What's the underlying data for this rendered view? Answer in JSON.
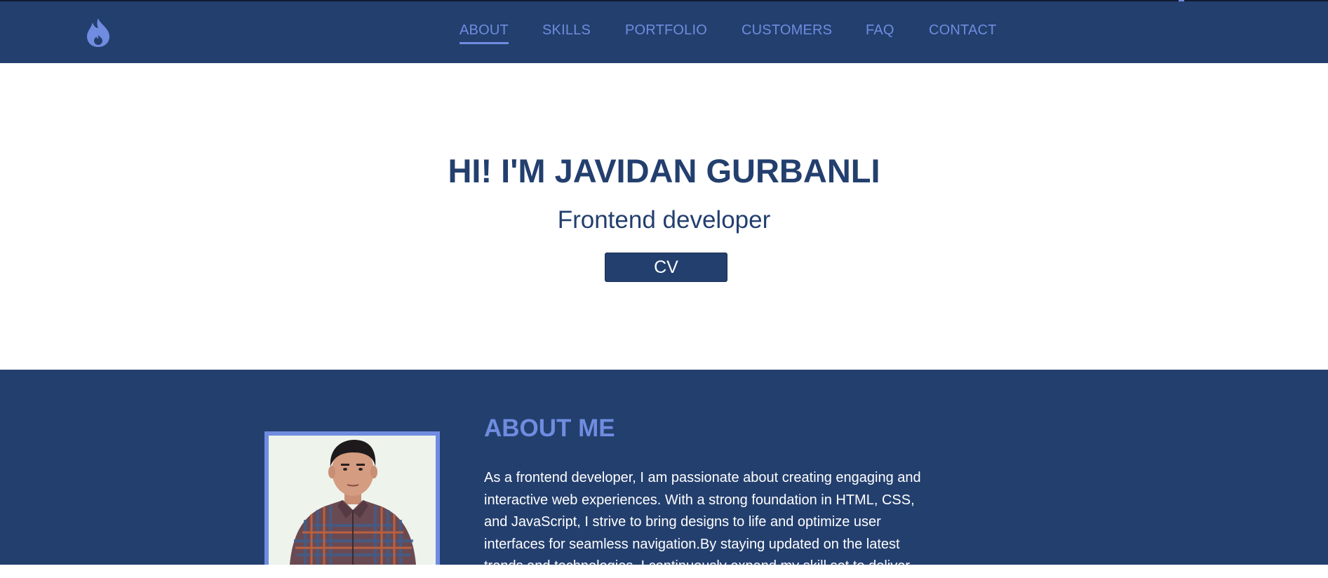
{
  "nav": {
    "items": [
      {
        "label": "ABOUT",
        "active": true
      },
      {
        "label": "SKILLS",
        "active": false
      },
      {
        "label": "PORTFOLIO",
        "active": false
      },
      {
        "label": "CUSTOMERS",
        "active": false
      },
      {
        "label": "FAQ",
        "active": false
      },
      {
        "label": "CONTACT",
        "active": false
      }
    ],
    "logo_icon": "flame-icon"
  },
  "hero": {
    "title": "HI! I'M JAVIDAN GURBANLI",
    "subtitle": "Frontend developer",
    "cv_label": "CV"
  },
  "about": {
    "title": "ABOUT ME",
    "photo_icon": "profile-photo",
    "text": "As a frontend developer, I am passionate about creating engaging and interactive web experiences. With a strong foundation in HTML, CSS, and JavaScript, I strive to bring designs to life and optimize user interfaces for seamless navigation.By staying updated on the latest trends and technologies, I continuously expand my skill set to deliver"
  },
  "colors": {
    "navy": "#233f6e",
    "accent": "#6f8ce0",
    "white": "#ffffff"
  }
}
